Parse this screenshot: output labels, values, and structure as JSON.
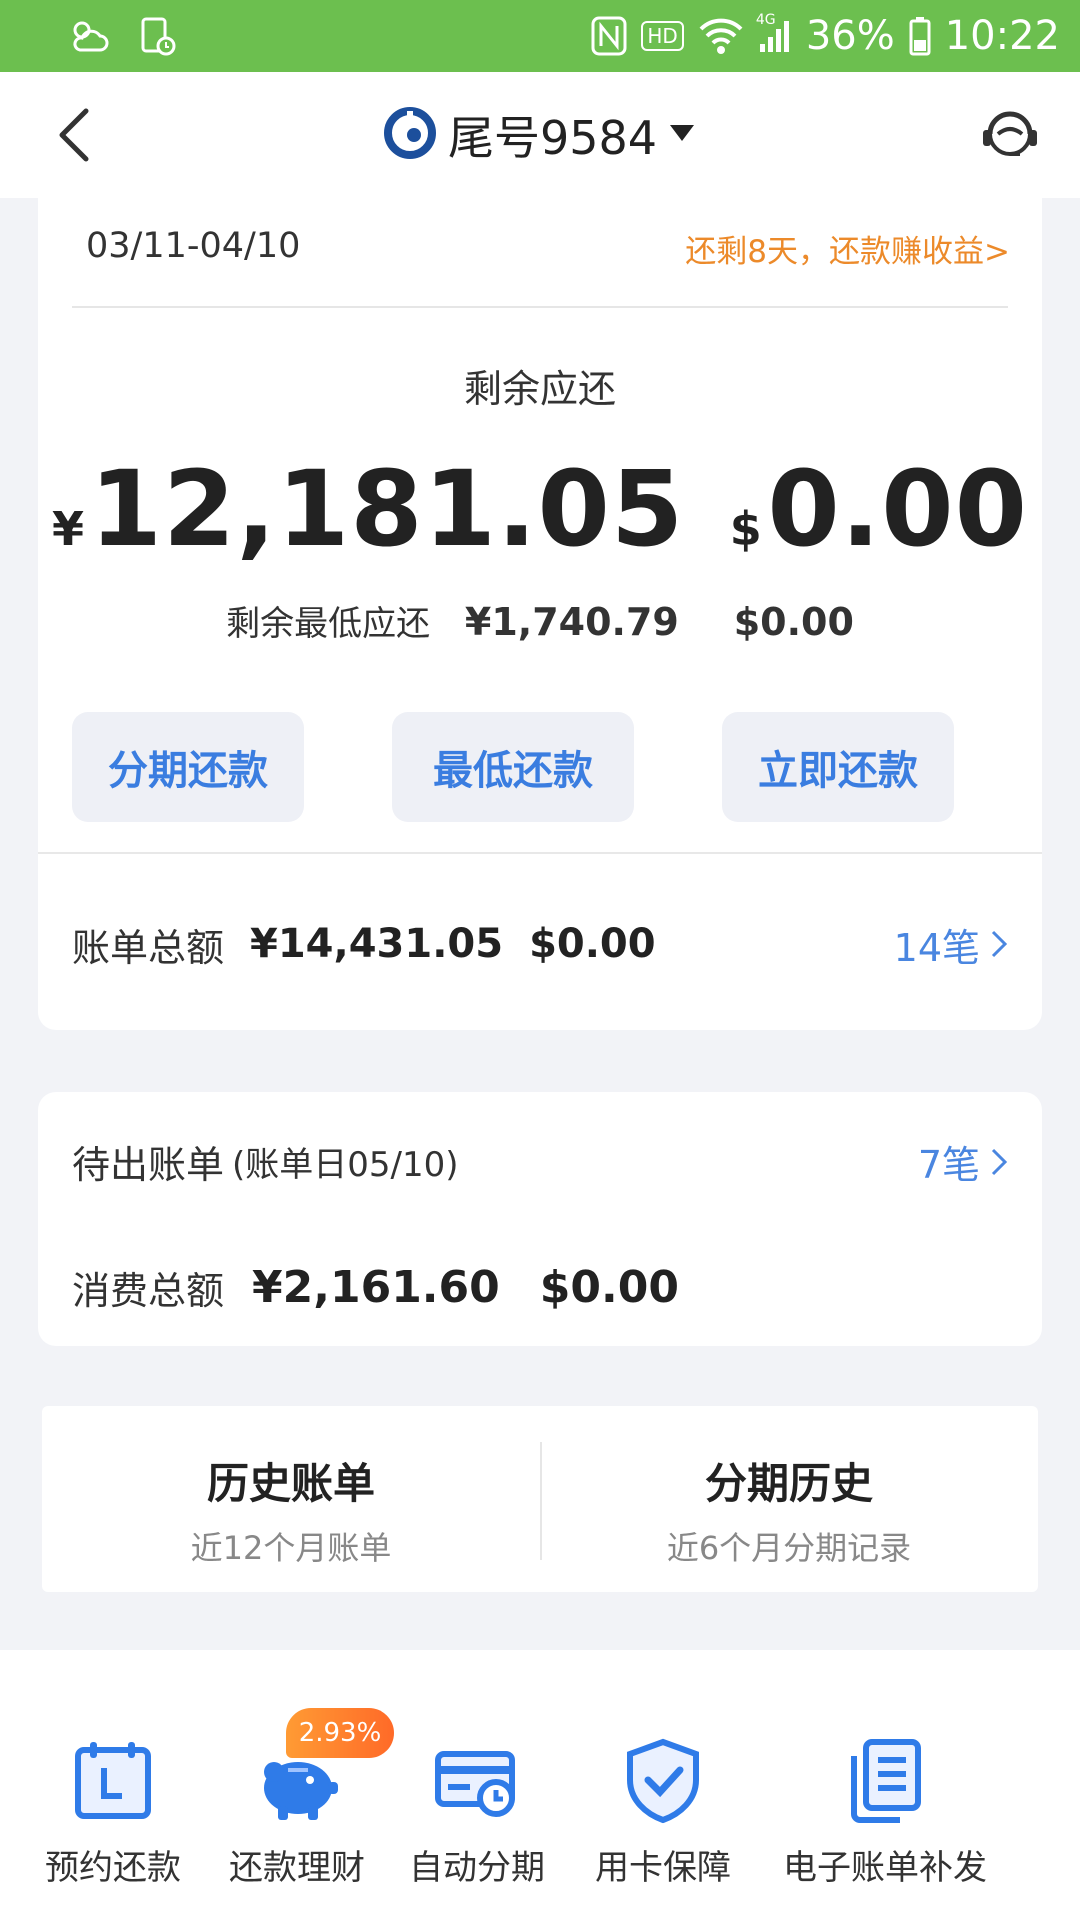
{
  "status_bar": {
    "battery": "36%",
    "time": "10:22",
    "hd": "HD",
    "net": "4G"
  },
  "header": {
    "title": "尾号9584"
  },
  "bill": {
    "period": "03/11-04/10",
    "reminder": "还剩8天，还款赚收益>",
    "remain_label": "剩余应还",
    "cny_symbol": "¥",
    "cny_amount": "12,181.05",
    "usd_symbol": "$",
    "usd_amount": "0.00",
    "min_label": "剩余最低应还",
    "min_cny": "¥1,740.79",
    "min_usd": "$0.00",
    "buttons": [
      "分期还款",
      "最低还款",
      "立即还款"
    ],
    "total_label": "账单总额",
    "total_cny": "¥14,431.05",
    "total_usd": "$0.00",
    "total_count": "14笔"
  },
  "pending": {
    "label": "待出账单",
    "sub": "(账单日05/10)",
    "count": "7笔",
    "spend_label": "消费总额",
    "spend_cny": "¥2,161.60",
    "spend_usd": "$0.00"
  },
  "history": {
    "bill_title": "历史账单",
    "bill_sub": "近12个月账单",
    "inst_title": "分期历史",
    "inst_sub": "近6个月分期记录"
  },
  "toolbar": {
    "badge": "2.93%",
    "items": [
      "预约还款",
      "还款理财",
      "自动分期",
      "用卡保障",
      "电子账单补发"
    ]
  },
  "colors": {
    "status_bar": "#6cbf4f",
    "accent_blue": "#3a7de0",
    "orange": "#ec8a2a"
  }
}
